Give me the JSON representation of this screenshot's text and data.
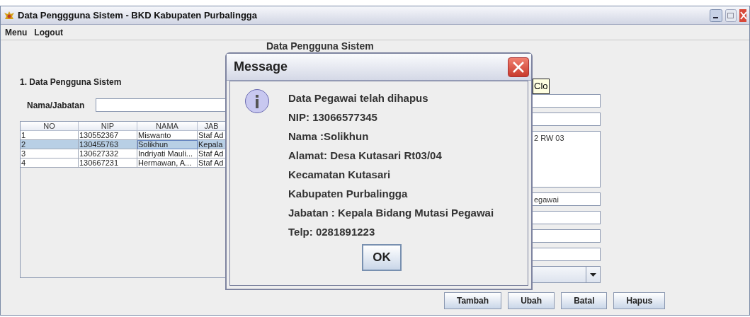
{
  "window": {
    "title": "Data Penggguna Sistem - BKD Kabupaten Purbalingga"
  },
  "menu": [
    "Menu",
    "Logout"
  ],
  "heading": "Data Pengguna Sistem",
  "section": {
    "title": "1. Data Pengguna Sistem",
    "search_label": "Nama/Jabatan"
  },
  "table": {
    "columns": [
      "NO",
      "NIP",
      "NAMA",
      "JAB"
    ],
    "rows": [
      {
        "cells": [
          "1",
          "130552367",
          "Miswanto",
          "Staf Ad"
        ],
        "selected": false
      },
      {
        "cells": [
          "2",
          "130455763",
          "Solikhun",
          "Kepala"
        ],
        "selected": true
      },
      {
        "cells": [
          "3",
          "130627332",
          "Indriyati Mauli...",
          "Staf Ad"
        ],
        "selected": false
      },
      {
        "cells": [
          "4",
          "130667231",
          "Hermawan, A...",
          "Staf Ad"
        ],
        "selected": false
      }
    ]
  },
  "form_fields": [
    {
      "kind": "text"
    },
    {
      "kind": "text"
    },
    {
      "kind": "area",
      "value": "2 RW 03"
    },
    {
      "kind": "text",
      "value": "egawai"
    },
    {
      "kind": "text"
    },
    {
      "kind": "text"
    },
    {
      "kind": "text"
    },
    {
      "kind": "combo"
    }
  ],
  "buttons": [
    "Tambah",
    "Ubah",
    "Batal",
    "Hapus"
  ],
  "dialog": {
    "title": "Message",
    "tooltip": "Clo",
    "lines": [
      "Data Pegawai telah dihapus",
      "NIP:  13066577345",
      "Nama :Solikhun",
      "Alamat: Desa Kutasari Rt03/04",
      "Kecamatan Kutasari",
      "Kabupaten Purbalingga",
      "Jabatan : Kepala Bidang Mutasi Pegawai",
      "Telp: 0281891223"
    ],
    "button": "OK"
  }
}
